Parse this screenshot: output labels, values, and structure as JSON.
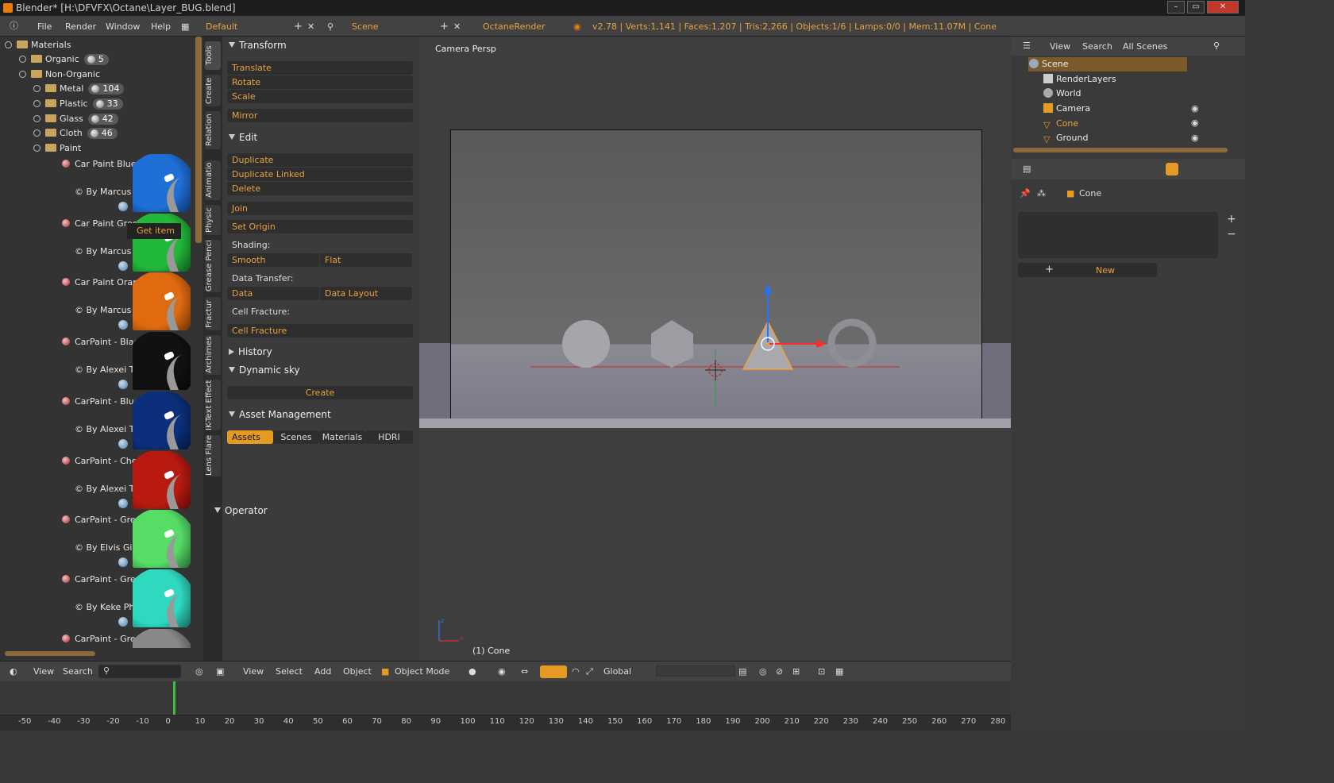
{
  "titlebar": {
    "title": "Blender* [H:\\DFVFX\\Octane\\Layer_BUG.blend]"
  },
  "menu": {
    "file": "File",
    "render": "Render",
    "window": "Window",
    "help": "Help",
    "layout": "Default",
    "scene": "Scene",
    "engine": "OctaneRender",
    "stats": "v2.78 | Verts:1,141 | Faces:1,207 | Tris:2,266 | Objects:1/6 | Lamps:0/0 | Mem:11.07M | Cone"
  },
  "library": {
    "materials": "Materials",
    "organic": "Organic",
    "organic_count": "5",
    "nonorganic": "Non-Organic",
    "metal": "Metal",
    "metal_count": "104",
    "plastic": "Plastic",
    "plastic_count": "33",
    "glass": "Glass",
    "glass_count": "42",
    "cloth": "Cloth",
    "cloth_count": "46",
    "paint": "Paint",
    "items": [
      {
        "name": "Car Paint Blue",
        "credit": "© By Marcus Fe",
        "color": "#1e6fd6"
      },
      {
        "name": "Car Paint Gree",
        "credit": "© By Marcus Fe",
        "color": "#22b83a"
      },
      {
        "name": "Car Paint Orang",
        "credit": "© By Marcus Fe",
        "color": "#e06a10"
      },
      {
        "name": "CarPaint - Black",
        "credit": "© By Alexei Tac",
        "color": "#111111"
      },
      {
        "name": "CarPaint - Blue I",
        "credit": "© By Alexei Tac",
        "color": "#0b2f7a"
      },
      {
        "name": "CarPaint - Cherr",
        "credit": "© By Alexei Tac",
        "color": "#b81a10"
      },
      {
        "name": "CarPaint - Greer",
        "credit": "© By Elvis Gint",
        "color": "#55dd66"
      },
      {
        "name": "CarPaint - Greer",
        "credit": "© By Keke Phili",
        "color": "#2fd9c0"
      },
      {
        "name": "CarPaint - Grey",
        "credit": "",
        "color": "#888888"
      }
    ],
    "get_item": "Get item"
  },
  "vtabs": [
    "Tools",
    "Create",
    "Relation",
    "Animatio",
    "Physic",
    "Grease Penci",
    "Fractur",
    "Archimes",
    "IK-Text Effect",
    "Lens Flare"
  ],
  "tools": {
    "transform": "Transform",
    "translate": "Translate",
    "rotate": "Rotate",
    "scale": "Scale",
    "mirror": "Mirror",
    "edit": "Edit",
    "duplicate": "Duplicate",
    "duplicate_linked": "Duplicate Linked",
    "delete": "Delete",
    "join": "Join",
    "set_origin": "Set Origin",
    "shading": "Shading:",
    "smooth": "Smooth",
    "flat": "Flat",
    "data_transfer": "Data Transfer:",
    "data": "Data",
    "data_layout": "Data Layout",
    "cell_fracture_label": "Cell Fracture:",
    "cell_fracture": "Cell Fracture",
    "history": "History",
    "dynamic_sky": "Dynamic sky",
    "create": "Create",
    "asset_mgmt": "Asset Management",
    "assets": "Assets",
    "scenes": "Scenes",
    "materials": "Materials",
    "hdri": "HDRI",
    "operator": "Operator"
  },
  "viewport": {
    "label": "Camera Persp",
    "object": "(1) Cone"
  },
  "vpbar": {
    "view": "View",
    "select": "Select",
    "add": "Add",
    "object": "Object",
    "mode": "Object Mode",
    "orientation": "Global"
  },
  "lbar": {
    "view": "View",
    "search": "Search"
  },
  "outliner": {
    "view": "View",
    "search": "Search",
    "scenes": "All Scenes",
    "scene": "Scene",
    "renderlayers": "RenderLayers",
    "world": "World",
    "camera": "Camera",
    "cone": "Cone",
    "ground": "Ground"
  },
  "props": {
    "object": "Cone",
    "new": "New"
  },
  "timeline": {
    "ticks": [
      "-50",
      "-40",
      "-30",
      "-20",
      "-10",
      "0",
      "10",
      "20",
      "30",
      "40",
      "50",
      "60",
      "70",
      "80",
      "90",
      "100",
      "110",
      "120",
      "130",
      "140",
      "150",
      "160",
      "170",
      "180",
      "190",
      "200",
      "210",
      "220",
      "230",
      "240",
      "250",
      "260",
      "270",
      "280"
    ]
  }
}
